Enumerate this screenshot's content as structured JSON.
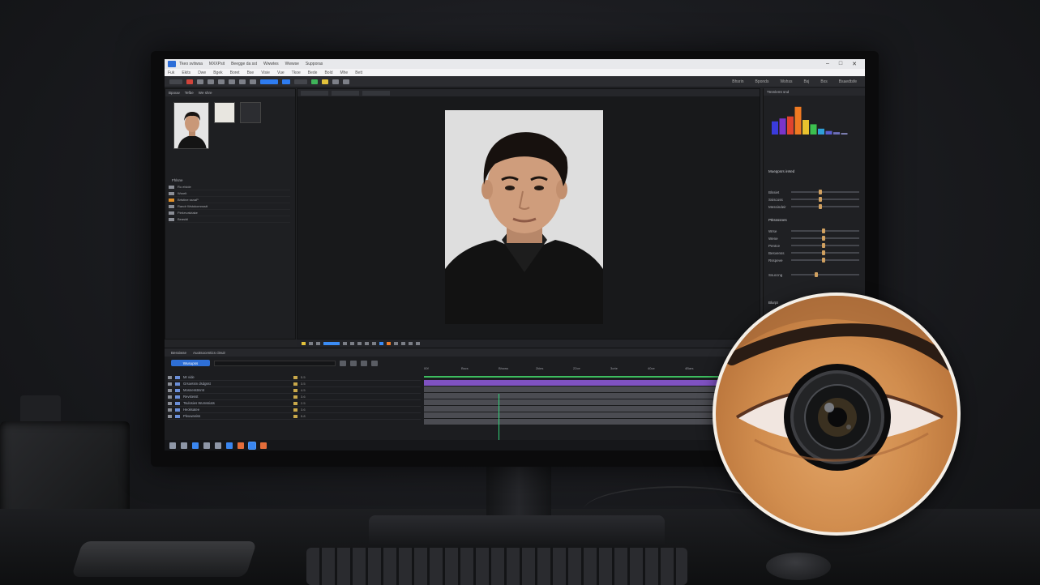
{
  "title_bar": {
    "items": [
      "Tkeo svitwsa",
      "MXXPsit",
      "Beegge da sst",
      "Wwwtes",
      "Wwwse",
      "Supporas"
    ]
  },
  "menu_bar": {
    "items": [
      "Fuk",
      "Ekits",
      "Dwe",
      "Bgek",
      "Boret",
      "Bse",
      "Visie",
      "Vue",
      "Tkoe",
      "Bede",
      "Bold",
      "Mhe",
      "Bett"
    ]
  },
  "toolbar": {
    "workspace_labels": [
      "Bhsrin",
      "Bponds",
      "Wshss",
      "Bsj",
      "Bxs",
      "Bsaedtsfe"
    ]
  },
  "project_panel": {
    "tabs": [
      "Bpouw",
      "Tefbe",
      "We shre"
    ],
    "files_header": "Fhlsne",
    "files": [
      {
        "name": "Ro elvide"
      },
      {
        "name": "Wsrelt"
      },
      {
        "name": "Brtstine ssnaP"
      },
      {
        "name": "Randr Wstokomnsstt"
      },
      {
        "name": "Ftekrrvalviake"
      },
      {
        "name": "Beasidi"
      }
    ]
  },
  "viewer": {
    "tabs": [
      "Wiss",
      "Artmiasi",
      "Boclen"
    ]
  },
  "right_panel": {
    "header": "Ttnmlemt snd",
    "section1": "Mueppsrs ireted",
    "s1_rows": [
      {
        "label": "Blssiet"
      },
      {
        "label": "Ssiscoss"
      },
      {
        "label": "Messindeir"
      }
    ],
    "section2": "Ptitssssnes",
    "s2_rows": [
      {
        "label": "Wrse"
      },
      {
        "label": "Wene"
      },
      {
        "label": "Pentce"
      },
      {
        "label": "Besvenss"
      },
      {
        "label": "Rsspeve"
      },
      {
        "label": "Ssuccng"
      }
    ],
    "footer": "Blurpt"
  },
  "timeline": {
    "tabs": [
      "Bessiwse",
      "Auotsocentics cleuir"
    ],
    "button": "Wusupss",
    "ruler": [
      "00f",
      "Bscs",
      "Bhows",
      "2kies",
      "22ce",
      "3crte",
      "40ce",
      "4Bars",
      "sBsos",
      "5rces",
      "6rcs"
    ],
    "layers": [
      {
        "name": "Mr vide",
        "val": "5.5"
      },
      {
        "name": "Grsoetsm dsdgsst",
        "val": "3.5"
      },
      {
        "name": "Mosnesstmmt",
        "val": "4.5"
      },
      {
        "name": "Revstesst",
        "val": "3.6"
      },
      {
        "name": "Tsulosies Wumssiats",
        "val": "2.5"
      },
      {
        "name": "Heoksatee",
        "val": "3.6"
      },
      {
        "name": "Pleuwaniss",
        "val": "5.8"
      }
    ]
  },
  "histogram": {
    "bars": [
      {
        "color": "#3a3bdc",
        "value": 0.45
      },
      {
        "color": "#7a34c9",
        "value": 0.55
      },
      {
        "color": "#e0432e",
        "value": 0.62
      },
      {
        "color": "#f07a22",
        "value": 0.95
      },
      {
        "color": "#e9c22e",
        "value": 0.5
      },
      {
        "color": "#3cc04f",
        "value": 0.35
      },
      {
        "color": "#2f9fd8",
        "value": 0.2
      },
      {
        "color": "#5a5ed0",
        "value": 0.12
      },
      {
        "color": "#6d6fb8",
        "value": 0.08
      },
      {
        "color": "#8a8cc5",
        "value": 0.05
      }
    ]
  },
  "accent": "#2e7cf0",
  "playhead_color": "#34d37a"
}
